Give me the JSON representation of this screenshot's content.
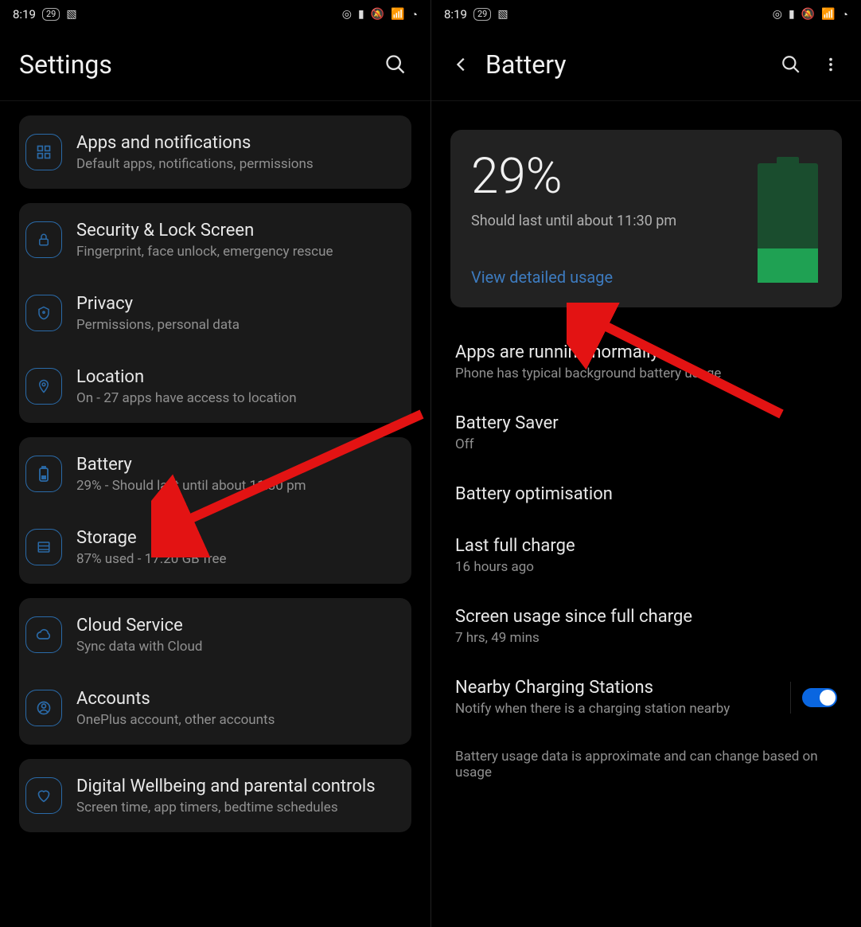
{
  "statusbar": {
    "time": "8:19",
    "battery_badge": "29",
    "icons_left": [
      "image-icon"
    ],
    "icons_right": [
      "hotspot-icon",
      "volte-icon",
      "silent-icon",
      "4g-signal-icon",
      "loading-icon"
    ]
  },
  "left": {
    "title": "Settings",
    "groups": [
      {
        "items": [
          {
            "icon": "apps-icon",
            "title": "Apps and notifications",
            "sub": "Default apps, notifications, permissions"
          }
        ]
      },
      {
        "items": [
          {
            "icon": "lock-icon",
            "title": "Security & Lock Screen",
            "sub": "Fingerprint, face unlock, emergency rescue"
          },
          {
            "icon": "shield-icon",
            "title": "Privacy",
            "sub": "Permissions, personal data"
          },
          {
            "icon": "location-icon",
            "title": "Location",
            "sub": "On - 27 apps have access to location"
          }
        ]
      },
      {
        "items": [
          {
            "icon": "battery-icon",
            "title": "Battery",
            "sub": "29% - Should last until about 11:30 pm"
          },
          {
            "icon": "storage-icon",
            "title": "Storage",
            "sub": "87% used - 17.20 GB free"
          }
        ]
      },
      {
        "items": [
          {
            "icon": "cloud-icon",
            "title": "Cloud Service",
            "sub": "Sync data with Cloud"
          },
          {
            "icon": "account-icon",
            "title": "Accounts",
            "sub": "OnePlus account, other accounts"
          }
        ]
      },
      {
        "items": [
          {
            "icon": "heart-icon",
            "title": "Digital Wellbeing and parental controls",
            "sub": "Screen time, app timers, bedtime schedules"
          }
        ]
      }
    ]
  },
  "right": {
    "title": "Battery",
    "summary": {
      "percent": "29%",
      "estimate": "Should last until about 11:30 pm",
      "link": "View detailed usage",
      "fill_pct": 29
    },
    "prefs": [
      {
        "title": "Apps are running normally",
        "sub": "Phone has typical background battery usage"
      },
      {
        "title": "Battery Saver",
        "sub": "Off"
      },
      {
        "title": "Battery optimisation",
        "sub": ""
      },
      {
        "title": "Last full charge",
        "sub": "16 hours ago"
      },
      {
        "title": "Screen usage since full charge",
        "sub": "7 hrs, 49 mins"
      },
      {
        "title": "Nearby Charging Stations",
        "sub": "Notify when there is a charging station nearby",
        "toggle": true,
        "toggle_on": true
      }
    ],
    "footnote": "Battery usage data is approximate and can change based on usage"
  },
  "colors": {
    "accent": "#2a6aa8",
    "link": "#3d7bbf",
    "arrow": "#e31313"
  }
}
